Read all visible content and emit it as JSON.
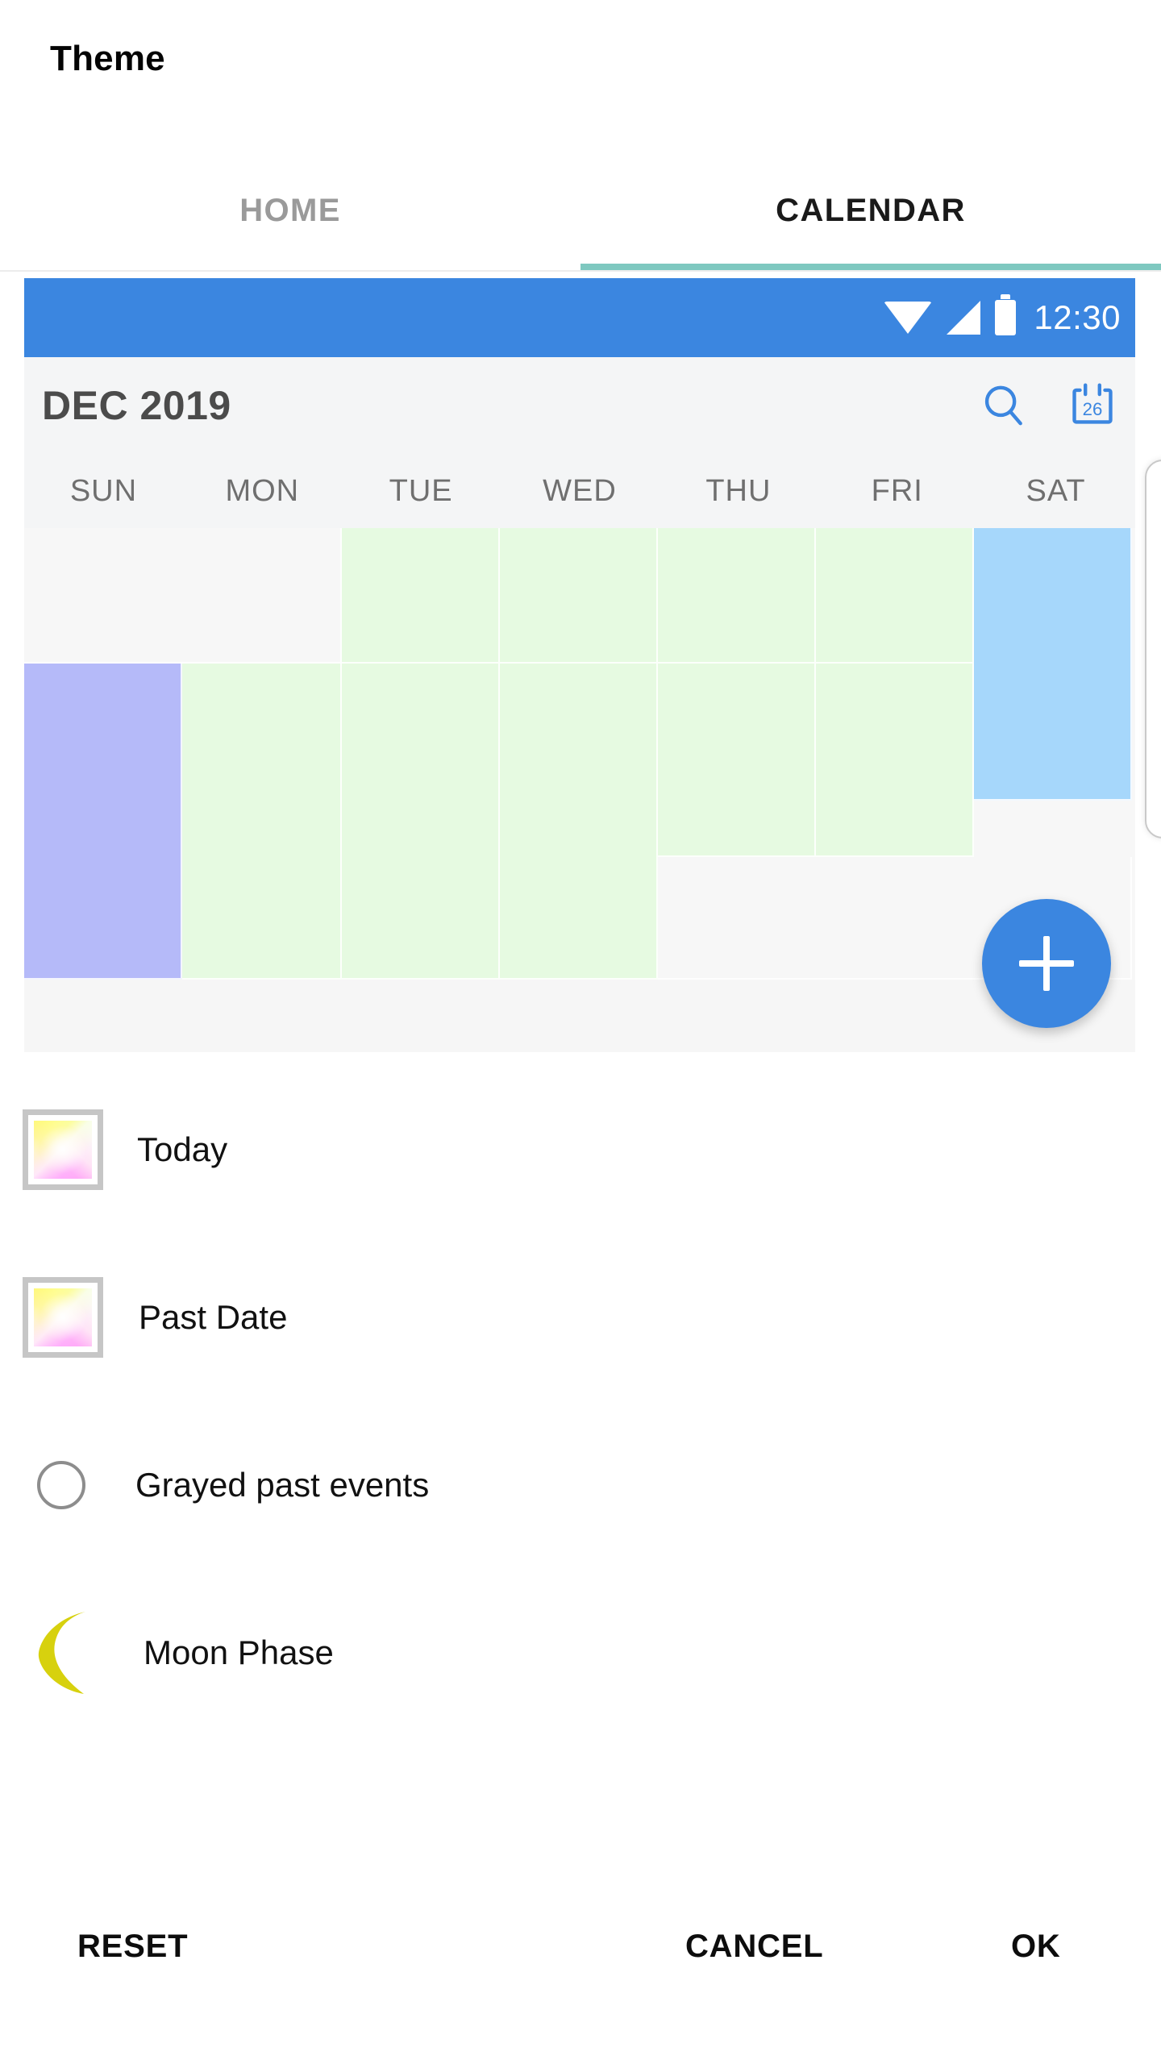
{
  "dialog": {
    "title": "Theme"
  },
  "tabs": [
    {
      "label": "HOME",
      "active": false
    },
    {
      "label": "CALENDAR",
      "active": true
    }
  ],
  "preview": {
    "status_bar": {
      "time": "12:30",
      "icons": [
        "wifi-icon",
        "signal-icon",
        "battery-icon"
      ],
      "background_color": "#3b86e0"
    },
    "toolbar": {
      "month_label": "DEC 2019",
      "actions": [
        {
          "name": "search-icon",
          "color": "#3b86e0"
        },
        {
          "name": "calendar-date-icon",
          "label": "26",
          "color": "#3b86e0"
        }
      ]
    },
    "weekdays": [
      "SUN",
      "MON",
      "TUE",
      "WED",
      "THU",
      "FRI",
      "SAT"
    ],
    "fab": {
      "name": "add-event-fab",
      "glyph": "+",
      "color": "#3b86e0"
    },
    "cell_colors": {
      "empty": "#f7f7f7",
      "past": "#e6fae1",
      "today": "#b5baf9",
      "saturday": "#a6d7fb"
    }
  },
  "options": [
    {
      "name": "today-color",
      "label": "Today",
      "control": "color-swatch"
    },
    {
      "name": "past-date-color",
      "label": "Past Date",
      "control": "color-swatch"
    },
    {
      "name": "grayed-past-events",
      "label": "Grayed past events",
      "control": "radio",
      "checked": false
    },
    {
      "name": "moon-phase",
      "label": "Moon Phase",
      "control": "moon-icon",
      "color": "#d7d10e"
    }
  ],
  "actions": {
    "reset_label": "RESET",
    "cancel_label": "CANCEL",
    "ok_label": "OK"
  },
  "theme": {
    "accent": "#3b86e0",
    "tab_indicator": "#7ec8c0"
  }
}
